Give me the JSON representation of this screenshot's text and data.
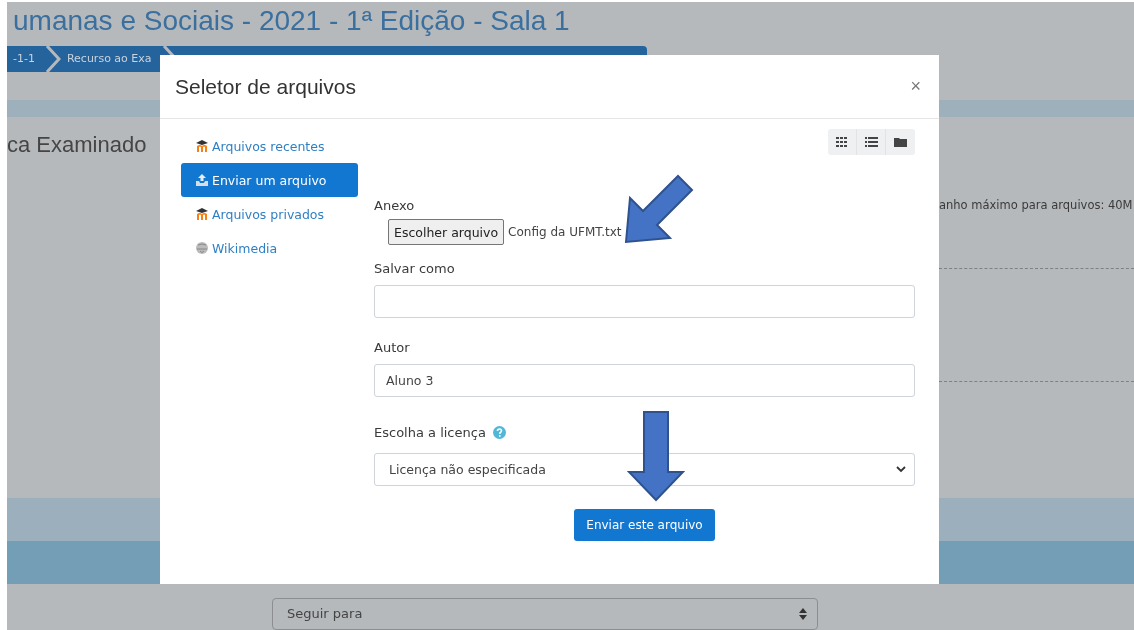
{
  "page": {
    "heading": "umanas e Sociais - 2021 - 1ª Edição - Sala 1",
    "breadcrumb": [
      {
        "label": "-1-1"
      },
      {
        "label": "Recurso ao Exa"
      }
    ],
    "section_heading": "ca Examinado",
    "max_size_note": "anho máximo para arquivos: 40M",
    "jump_select": {
      "value": "Seguir para"
    }
  },
  "dialog": {
    "title": "Seletor de arquivos",
    "close": "×",
    "repositories": [
      {
        "label": "Arquivos recentes",
        "kind": "moodle",
        "selected": false
      },
      {
        "label": "Enviar um arquivo",
        "kind": "upload",
        "selected": true
      },
      {
        "label": "Arquivos privados",
        "kind": "moodle",
        "selected": false
      },
      {
        "label": "Wikimedia",
        "kind": "wiki",
        "selected": false
      }
    ],
    "view_buttons": [
      {
        "kind": "icons"
      },
      {
        "kind": "list"
      },
      {
        "kind": "tree"
      }
    ],
    "attachment": {
      "label": "Anexo",
      "button": "Escolher arquivo",
      "filename": "Config da UFMT.txt"
    },
    "save_as": {
      "label": "Salvar como"
    },
    "author": {
      "label": "Autor",
      "value": "Aluno 3"
    },
    "license": {
      "label": "Escolha a licença",
      "value": "Licença não especificada"
    },
    "submit": "Enviar este arquivo"
  },
  "annotations": [
    {
      "kind": "arrow_down_left"
    },
    {
      "kind": "arrow_down"
    }
  ]
}
